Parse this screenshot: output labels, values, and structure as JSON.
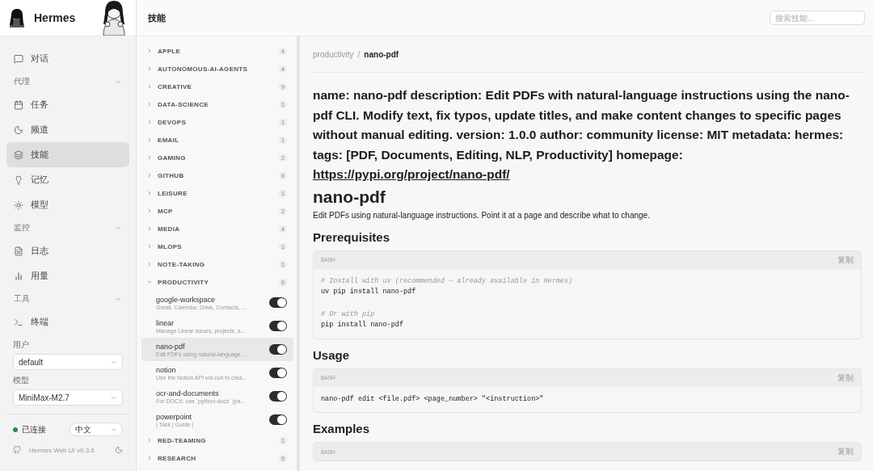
{
  "sidebar": {
    "brand": "Hermes",
    "nav": [
      {
        "kind": "item",
        "label": "对话",
        "selected": false
      },
      {
        "kind": "section",
        "label": "代理",
        "expanded": true,
        "children": [
          {
            "label": "任务",
            "selected": false
          },
          {
            "label": "频道",
            "selected": false
          },
          {
            "label": "技能",
            "selected": true
          },
          {
            "label": "记忆",
            "selected": false
          },
          {
            "label": "模型",
            "selected": false
          }
        ]
      },
      {
        "kind": "section",
        "label": "监控",
        "expanded": true,
        "children": [
          {
            "label": "日志",
            "selected": false
          },
          {
            "label": "用量",
            "selected": false
          }
        ]
      },
      {
        "kind": "section",
        "label": "工具",
        "expanded": true,
        "children": [
          {
            "label": "终端",
            "selected": false
          }
        ]
      }
    ],
    "user": {
      "label": "用户",
      "value": "default"
    },
    "model": {
      "label": "模型",
      "value": "MiniMax-M2.7"
    },
    "status": {
      "label": "已连接",
      "connected": true
    },
    "language": "中文",
    "version": "Hermes Web UI v0.3.6"
  },
  "header": {
    "title": "技能",
    "search": {
      "placeholder": "搜索技能..."
    }
  },
  "categories": [
    {
      "name": "APPLE",
      "count": "4",
      "expanded": false
    },
    {
      "name": "AUTONOMOUS-AI-AGENTS",
      "count": "4",
      "expanded": false
    },
    {
      "name": "CREATIVE",
      "count": "9",
      "expanded": false
    },
    {
      "name": "DATA-SCIENCE",
      "count": "1",
      "expanded": false
    },
    {
      "name": "DEVOPS",
      "count": "1",
      "expanded": false
    },
    {
      "name": "EMAIL",
      "count": "1",
      "expanded": false
    },
    {
      "name": "GAMING",
      "count": "2",
      "expanded": false
    },
    {
      "name": "GITHUB",
      "count": "6",
      "expanded": false
    },
    {
      "name": "LEISURE",
      "count": "1",
      "expanded": false
    },
    {
      "name": "MCP",
      "count": "2",
      "expanded": false
    },
    {
      "name": "MEDIA",
      "count": "4",
      "expanded": false
    },
    {
      "name": "MLOPS",
      "count": "1",
      "expanded": false
    },
    {
      "name": "NOTE-TAKING",
      "count": "1",
      "expanded": false
    },
    {
      "name": "PRODUCTIVITY",
      "count": "6",
      "expanded": true,
      "skills": [
        {
          "name": "google-workspace",
          "description": "Gmail, Calendar, Drive, Contacts, ...",
          "enabled": true,
          "selected": false
        },
        {
          "name": "linear",
          "description": "Manage Linear issues, projects, a...",
          "enabled": true,
          "selected": false
        },
        {
          "name": "nano-pdf",
          "description": "Edit PDFs using natural-language ...",
          "enabled": true,
          "selected": true
        },
        {
          "name": "notion",
          "description": "Use the Notion API via curl to crea...",
          "enabled": true,
          "selected": false
        },
        {
          "name": "ocr-and-documents",
          "description": "For DOCX: use `python-docx` (pa...",
          "enabled": true,
          "selected": false
        },
        {
          "name": "powerpoint",
          "description": "| Task | Guide |",
          "enabled": true,
          "selected": false
        }
      ]
    },
    {
      "name": "RED-TEAMING",
      "count": "1",
      "expanded": false
    },
    {
      "name": "RESEARCH",
      "count": "5",
      "expanded": false
    }
  ],
  "detail": {
    "breadcrumb": [
      "productivity",
      "nano-pdf"
    ],
    "breadcrumb_separator": "/",
    "blocks": [
      {
        "kind": "frontmatter",
        "text": "name: nano-pdf description: Edit PDFs with natural-language instructions using the nano-pdf CLI. Modify text, fix typos, update titles, and make content changes to specific pages without manual editing. version: 1.0.0 author: community license: MIT metadata: hermes: tags: [PDF, Documents, Editing, NLP, Productivity] homepage:",
        "link": "https://pypi.org/project/nano-pdf/"
      },
      {
        "kind": "h1",
        "text": "nano-pdf"
      },
      {
        "kind": "p",
        "text": "Edit PDFs using natural-language instructions. Point it at a page and describe what to change."
      },
      {
        "kind": "h2",
        "text": "Prerequisites"
      },
      {
        "kind": "code",
        "lang": "BASH",
        "copy": "复制",
        "groups": [
          [
            {
              "text": "# Install with uv (recommended — already available in Hermes)",
              "comment": true
            },
            {
              "text": "uv pip install nano-pdf",
              "comment": false
            }
          ],
          [
            {
              "text": "# Or with pip",
              "comment": true
            },
            {
              "text": "pip install nano-pdf",
              "comment": false
            }
          ]
        ]
      },
      {
        "kind": "h2",
        "text": "Usage"
      },
      {
        "kind": "code",
        "lang": "BASH",
        "copy": "复制",
        "groups": [
          [
            {
              "text": "nano-pdf edit <file.pdf> <page_number> \"<instruction>\"",
              "comment": false
            }
          ]
        ]
      },
      {
        "kind": "h2",
        "text": "Examples"
      },
      {
        "kind": "code",
        "lang": "BASH",
        "copy": "复制"
      }
    ]
  }
}
